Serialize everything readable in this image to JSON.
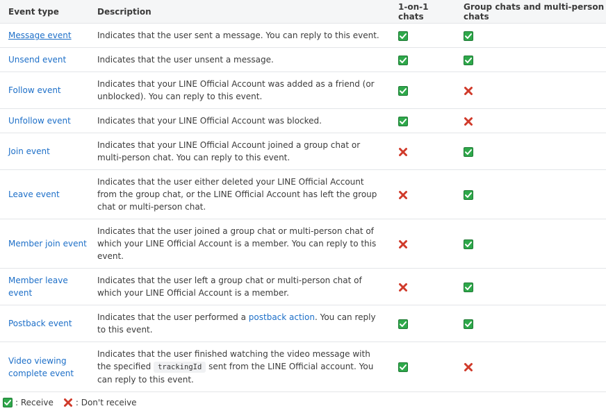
{
  "headers": {
    "event_type": "Event type",
    "description": "Description",
    "one_on_one": "1-on-1 chats",
    "group": "Group chats and multi-person chats"
  },
  "rows": [
    {
      "name": "Message event",
      "desc": "Indicates that the user sent a message. You can reply to this event.",
      "one": "check",
      "group": "check"
    },
    {
      "name": "Unsend event",
      "desc": "Indicates that the user unsent a message.",
      "one": "check",
      "group": "check"
    },
    {
      "name": "Follow event",
      "desc": "Indicates that your LINE Official Account was added as a friend (or unblocked). You can reply to this event.",
      "one": "check",
      "group": "cross"
    },
    {
      "name": "Unfollow event",
      "desc": "Indicates that your LINE Official Account was blocked.",
      "one": "check",
      "group": "cross"
    },
    {
      "name": "Join event",
      "desc": "Indicates that your LINE Official Account joined a group chat or multi-person chat. You can reply to this event.",
      "one": "cross",
      "group": "check"
    },
    {
      "name": "Leave event",
      "desc": "Indicates that the user either deleted your LINE Official Account from the group chat, or the LINE Official Account has left the group chat or multi-person chat.",
      "one": "cross",
      "group": "check"
    },
    {
      "name": "Member join event",
      "desc": "Indicates that the user joined a group chat or multi-person chat of which your LINE Official Account is a member. You can reply to this event.",
      "one": "cross",
      "group": "check"
    },
    {
      "name": "Member leave event",
      "desc": "Indicates that the user left a group chat or multi-person chat of which your LINE Official Account is a member.",
      "one": "cross",
      "group": "check"
    },
    {
      "name": "Postback event",
      "desc_pre": "Indicates that the user performed a ",
      "desc_link": "postback action",
      "desc_post": ". You can reply to this event.",
      "one": "check",
      "group": "check"
    },
    {
      "name": "Video viewing complete event",
      "desc_pre": "Indicates that the user finished watching the video message with the specified ",
      "desc_code": "trackingId",
      "desc_post": " sent from the LINE Official account. You can reply to this event.",
      "one": "check",
      "group": "cross"
    }
  ],
  "legend": {
    "receive": ": Receive",
    "dont_receive": ": Don't receive"
  },
  "colors": {
    "check_fill": "#2ea84a",
    "cross_fill": "#d03a2a",
    "link": "#1d6fc8"
  },
  "icons": {
    "check": "check-icon",
    "cross": "cross-icon"
  }
}
